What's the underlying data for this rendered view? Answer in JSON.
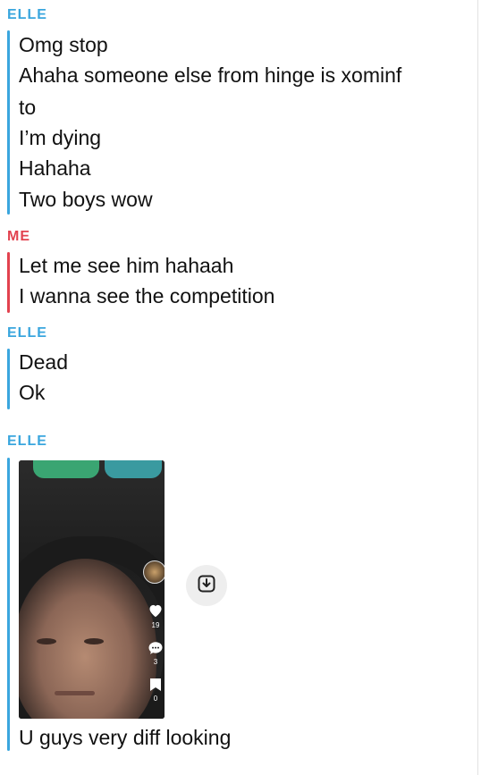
{
  "conversation": [
    {
      "sender": "ELLE",
      "messages": [
        "Omg stop",
        "Ahaha someone else from hinge is xominf",
        "to",
        "I’m dying",
        "Hahaha",
        "Two boys wow"
      ]
    },
    {
      "sender": "ME",
      "messages": [
        "Let me see him hahaah",
        "I wanna see the competition"
      ]
    },
    {
      "sender": "ELLE",
      "messages": [
        "Dead",
        "Ok"
      ]
    },
    {
      "sender": "ELLE",
      "media": {
        "likes": "19",
        "comments": "3",
        "saves": "0"
      },
      "messages": [
        "U guys very diff looking"
      ]
    }
  ],
  "colors": {
    "elle": "#3aa6de",
    "me": "#e2424f"
  },
  "icons": {
    "save": "download-box-icon",
    "like": "heart-icon",
    "comment": "speech-bubble-icon",
    "bookmark": "bookmark-icon"
  }
}
